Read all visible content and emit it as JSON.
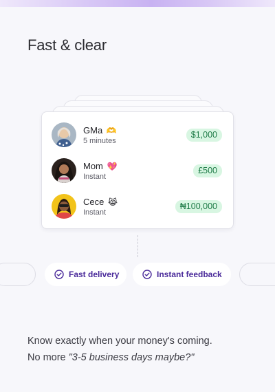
{
  "page": {
    "heading": "Fast & clear"
  },
  "transfers": [
    {
      "name": "GMa",
      "emoji": "🫶",
      "time": "5 minutes",
      "amount": "$1,000"
    },
    {
      "name": "Mom",
      "emoji": "💖",
      "time": "Instant",
      "amount": "£500"
    },
    {
      "name": "Cece",
      "emoji": "😹",
      "time": "Instant",
      "amount": "₦100,000"
    }
  ],
  "features": [
    {
      "label": "Fast delivery",
      "icon": "check-circle-icon"
    },
    {
      "label": "Instant feedback",
      "icon": "check-circle-icon"
    }
  ],
  "body": {
    "line1": "Know exactly when your money's coming.",
    "line2_prefix": "No more ",
    "line2_quote": "\"3-5 business days maybe?\""
  },
  "colors": {
    "accent": "#4a2a9a",
    "amount_bg": "#d8f6e2",
    "amount_text": "#1d7a46"
  }
}
